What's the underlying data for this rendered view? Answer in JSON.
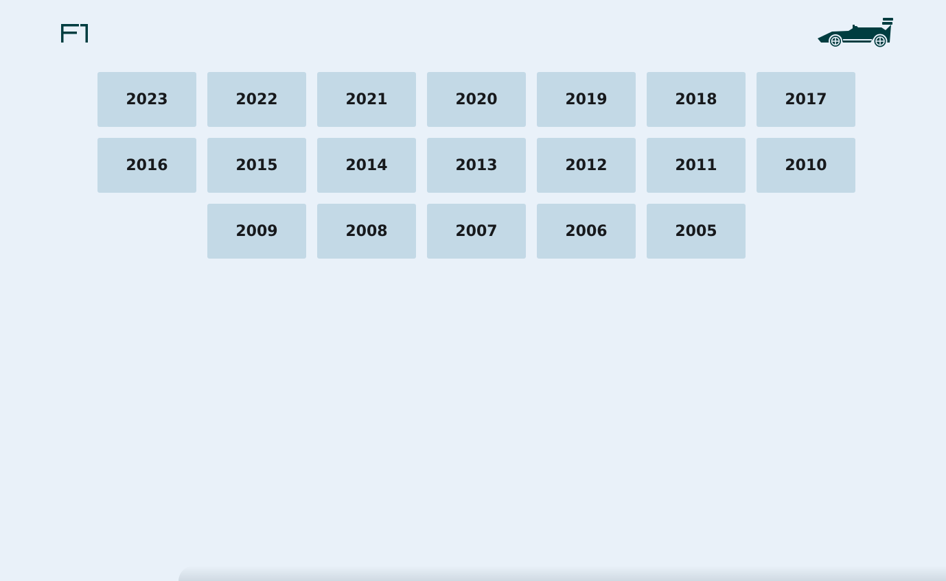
{
  "header": {
    "logo_icon": "f1-logo-icon",
    "car_icon": "f1-car-icon",
    "brand_color": "#003d40"
  },
  "years": [
    "2023",
    "2022",
    "2021",
    "2020",
    "2019",
    "2018",
    "2017",
    "2016",
    "2015",
    "2014",
    "2013",
    "2012",
    "2011",
    "2010",
    "2009",
    "2008",
    "2007",
    "2006",
    "2005"
  ],
  "colors": {
    "background": "#e9f1f9",
    "tile": "#c3d9e6",
    "tile_text": "#17191c"
  }
}
